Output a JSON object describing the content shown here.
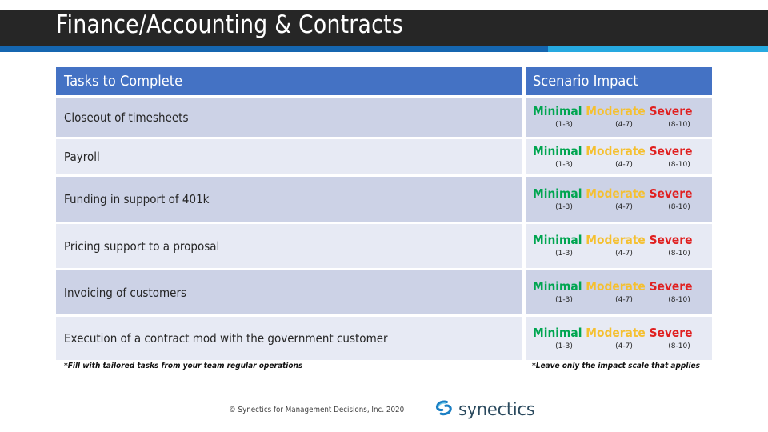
{
  "header": {
    "title": "Finance/Accounting & Contracts",
    "band_color": "#262626",
    "accent_left_color": "#1566b0",
    "accent_right_color": "#26a9e0"
  },
  "table": {
    "header_bg": "#4472c4",
    "columns": [
      {
        "label": "Tasks to Complete"
      },
      {
        "label": "Scenario Impact"
      }
    ],
    "impact_labels": {
      "minimal": "Minimal",
      "moderate": "Moderate",
      "severe": "Severe",
      "minimal_range": "(1-3)",
      "moderate_range": "(4-7)",
      "severe_range": "(8-10)",
      "minimal_color": "#00a550",
      "moderate_color": "#f5c030",
      "severe_color": "#e02020"
    },
    "rows": [
      {
        "task": "Closeout of timesheets"
      },
      {
        "task": "Payroll"
      },
      {
        "task": "Funding in support of 401k"
      },
      {
        "task": "Pricing support to a proposal"
      },
      {
        "task": "Invoicing of customers"
      },
      {
        "task": "Execution of a contract mod with the government customer"
      }
    ]
  },
  "footnotes": {
    "left": "*Fill with tailored tasks from your team regular operations",
    "right": "*Leave only the impact scale that applies"
  },
  "footer": {
    "copyright": "© Synectics for Management Decisions, Inc. 2020",
    "logo_word": "synectics",
    "logo_color": "#1b7fc4"
  }
}
